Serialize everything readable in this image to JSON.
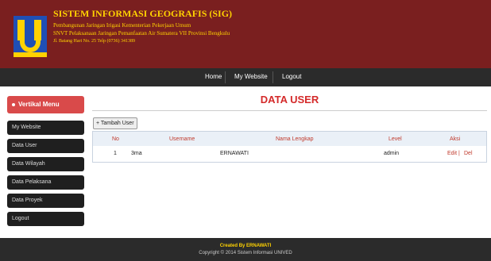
{
  "header": {
    "title": "SISTEM INFORMASI GEOGRAFIS (SIG)",
    "line1": "Pembangunan Jaringan Irigasi Kementerian Pekerjaan Umum",
    "line2": "SNVT Pelaksanaan Jaringan Pemanfaatan Air Sumatera VII Provinsi Bengkulu",
    "line3": "Jl. Batang Hari No. 25 Telp (0736) 341389",
    "colors": {
      "background": "#7a1f1f",
      "text": "#ffd200"
    }
  },
  "nav": {
    "items": [
      "Home",
      "My Website",
      "Logout"
    ]
  },
  "sidebar": {
    "heading": "Vertikal Menu",
    "items": [
      "My Website",
      "Data User",
      "Data Wilayah",
      "Data Pelaksana",
      "Data Proyek",
      "Logout"
    ]
  },
  "main": {
    "title": "DATA USER",
    "add_button": "+ Tambah User",
    "table": {
      "headers": [
        "No",
        "Username",
        "Nama Lengkap",
        "Level",
        "Aksi"
      ],
      "rows": [
        {
          "no": "1",
          "username": "3ma",
          "nama": "ERNAWATI",
          "level": "admin",
          "edit": "Edit",
          "sep": " | ",
          "del": "Del"
        }
      ]
    }
  },
  "footer": {
    "credit": "Created By ERNAWATI",
    "copyright": "Copyright © 2014 Sistem Informasi UNIVED"
  }
}
